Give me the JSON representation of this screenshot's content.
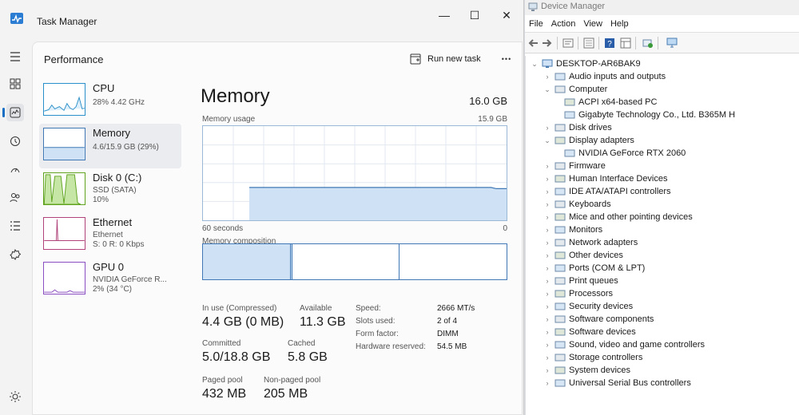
{
  "task_manager": {
    "title": "Task Manager",
    "window_buttons": {
      "minimize": "—",
      "maximize": "☐",
      "close": "✕"
    },
    "section_title": "Performance",
    "run_new_task": "Run new task",
    "more": "•••",
    "resources": [
      {
        "name": "CPU",
        "line1": "28%  4.42 GHz",
        "line2": ""
      },
      {
        "name": "Memory",
        "line1": "4.6/15.9 GB (29%)",
        "line2": ""
      },
      {
        "name": "Disk 0 (C:)",
        "line1": "SSD (SATA)",
        "line2": "10%"
      },
      {
        "name": "Ethernet",
        "line1": "Ethernet",
        "line2": "S: 0  R: 0 Kbps"
      },
      {
        "name": "GPU 0",
        "line1": "NVIDIA GeForce R...",
        "line2": "2%  (34 °C)"
      }
    ],
    "memory": {
      "title": "Memory",
      "total": "16.0 GB",
      "usage_label": "Memory usage",
      "usage_max": "15.9 GB",
      "axis_left": "60 seconds",
      "axis_right": "0",
      "composition_label": "Memory composition",
      "composition_in_use_fraction": 0.29,
      "stats": {
        "in_use_label": "In use (Compressed)",
        "in_use_value": "4.4 GB (0 MB)",
        "available_label": "Available",
        "available_value": "11.3 GB",
        "committed_label": "Committed",
        "committed_value": "5.0/18.8 GB",
        "cached_label": "Cached",
        "cached_value": "5.8 GB",
        "paged_label": "Paged pool",
        "paged_value": "432 MB",
        "nonpaged_label": "Non-paged pool",
        "nonpaged_value": "205 MB"
      },
      "details": [
        {
          "label": "Speed:",
          "value": "2666 MT/s"
        },
        {
          "label": "Slots used:",
          "value": "2 of 4"
        },
        {
          "label": "Form factor:",
          "value": "DIMM"
        },
        {
          "label": "Hardware reserved:",
          "value": "54.5 MB"
        }
      ],
      "usage_series_fraction_of_max": [
        0.0,
        0.0,
        0.0,
        0.0,
        0.0,
        0.0,
        0.0,
        0.0,
        0.0,
        0.29,
        0.29,
        0.29,
        0.29,
        0.29,
        0.29,
        0.29,
        0.29,
        0.29,
        0.29,
        0.29,
        0.29,
        0.29,
        0.29,
        0.29,
        0.29,
        0.29,
        0.29,
        0.29,
        0.29,
        0.29,
        0.29,
        0.29,
        0.29,
        0.29,
        0.29,
        0.29,
        0.29,
        0.29,
        0.29,
        0.29,
        0.29,
        0.29,
        0.29,
        0.29,
        0.29,
        0.29,
        0.29,
        0.29,
        0.29,
        0.29,
        0.29,
        0.29,
        0.29,
        0.29,
        0.29,
        0.29,
        0.29,
        0.28,
        0.28,
        0.28
      ]
    }
  },
  "device_manager": {
    "title": "Device Manager",
    "menu": [
      "File",
      "Action",
      "View",
      "Help"
    ],
    "tree": {
      "root": "DESKTOP-AR6BAK9",
      "items": [
        {
          "label": "Audio inputs and outputs",
          "expanded": false,
          "level": 1
        },
        {
          "label": "Computer",
          "expanded": true,
          "level": 1
        },
        {
          "label": "ACPI x64-based PC",
          "level": 2
        },
        {
          "label": "Gigabyte Technology Co., Ltd. B365M H",
          "level": 2
        },
        {
          "label": "Disk drives",
          "expanded": false,
          "level": 1
        },
        {
          "label": "Display adapters",
          "expanded": true,
          "level": 1
        },
        {
          "label": "NVIDIA GeForce RTX 2060",
          "level": 2
        },
        {
          "label": "Firmware",
          "expanded": false,
          "level": 1
        },
        {
          "label": "Human Interface Devices",
          "expanded": false,
          "level": 1
        },
        {
          "label": "IDE ATA/ATAPI controllers",
          "expanded": false,
          "level": 1
        },
        {
          "label": "Keyboards",
          "expanded": false,
          "level": 1
        },
        {
          "label": "Mice and other pointing devices",
          "expanded": false,
          "level": 1
        },
        {
          "label": "Monitors",
          "expanded": false,
          "level": 1
        },
        {
          "label": "Network adapters",
          "expanded": false,
          "level": 1
        },
        {
          "label": "Other devices",
          "expanded": false,
          "level": 1
        },
        {
          "label": "Ports (COM & LPT)",
          "expanded": false,
          "level": 1
        },
        {
          "label": "Print queues",
          "expanded": false,
          "level": 1
        },
        {
          "label": "Processors",
          "expanded": false,
          "level": 1
        },
        {
          "label": "Security devices",
          "expanded": false,
          "level": 1
        },
        {
          "label": "Software components",
          "expanded": false,
          "level": 1
        },
        {
          "label": "Software devices",
          "expanded": false,
          "level": 1
        },
        {
          "label": "Sound, video and game controllers",
          "expanded": false,
          "level": 1
        },
        {
          "label": "Storage controllers",
          "expanded": false,
          "level": 1
        },
        {
          "label": "System devices",
          "expanded": false,
          "level": 1
        },
        {
          "label": "Universal Serial Bus controllers",
          "expanded": false,
          "level": 1
        }
      ]
    }
  },
  "colors": {
    "accent": "#1a6fc4",
    "graph_fill": "#cfe1f5",
    "graph_line": "#3f78b5",
    "cpu_line": "#2b8fc9",
    "disk_fill": "#c6e6a5",
    "disk_line": "#5fa31f",
    "eth_line": "#b0447a",
    "gpu_line": "#8a4fc0"
  }
}
